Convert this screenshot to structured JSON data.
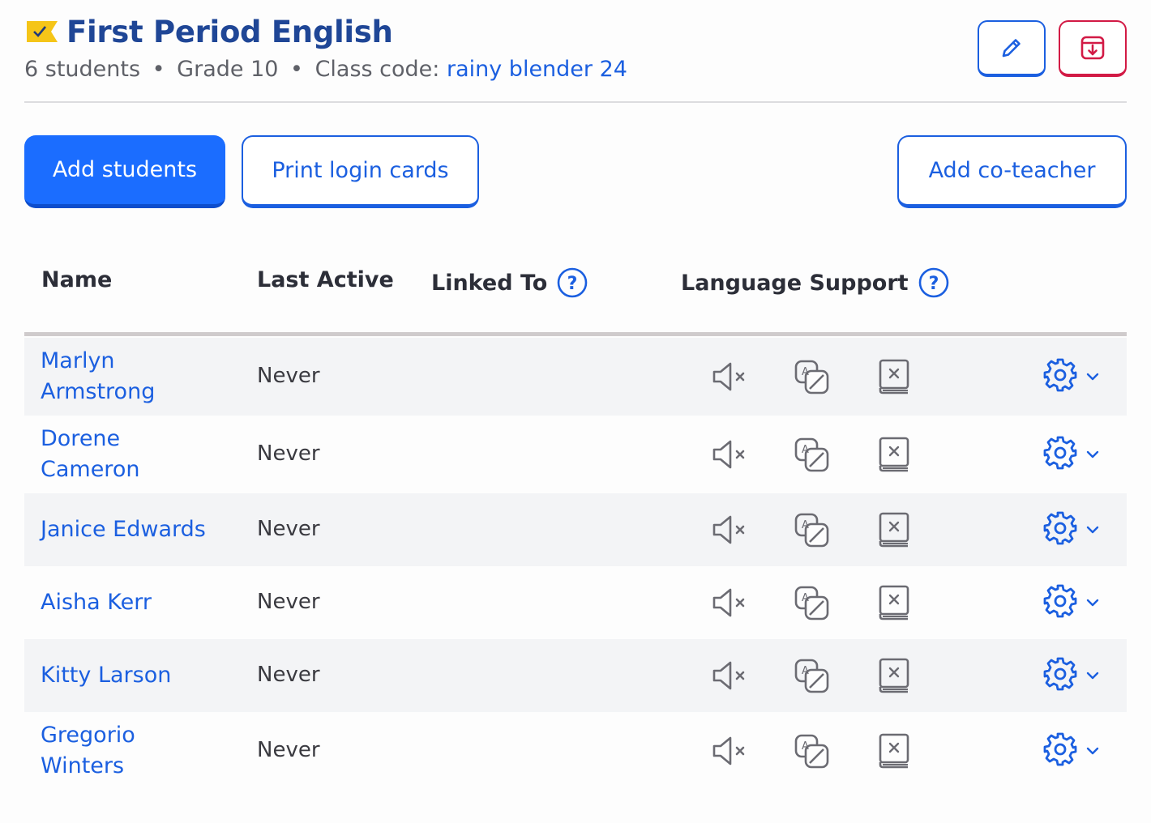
{
  "class": {
    "title": "First Period English",
    "students": "6 students",
    "grade": "Grade 10",
    "code_label": "Class code:",
    "code_value": "rainy blender 24",
    "separator": "•",
    "flag_color": "#f5c518"
  },
  "actions": {
    "add_students": "Add students",
    "print_login_cards": "Print login cards",
    "add_co_teacher": "Add co-teacher"
  },
  "table": {
    "headers": {
      "name": "Name",
      "last_active": "Last Active",
      "linked_to": "Linked To",
      "language_support": "Language Support"
    },
    "rows": [
      {
        "first": "Marlyn",
        "last": "Armstrong",
        "last_active": "Never"
      },
      {
        "first": "Dorene",
        "last": "Cameron",
        "last_active": "Never"
      },
      {
        "first": "Janice Edwards",
        "last": "",
        "last_active": "Never"
      },
      {
        "first": "Aisha Kerr",
        "last": "",
        "last_active": "Never"
      },
      {
        "first": "Kitty Larson",
        "last": "",
        "last_active": "Never"
      },
      {
        "first": "Gregorio",
        "last": "Winters",
        "last_active": "Never"
      }
    ]
  },
  "icons": {
    "audio": "speaker-muted-icon",
    "translation": "translation-icon",
    "dictionary": "dictionary-off-icon",
    "settings": "gear-icon",
    "chevron": "chevron-down-icon",
    "help": "help-circle-icon",
    "edit": "pencil-icon",
    "archive": "archive-icon"
  },
  "colors": {
    "primary": "#1b6dff",
    "link": "#1b5fe0",
    "danger": "#d21a45",
    "title": "#1f4696"
  }
}
